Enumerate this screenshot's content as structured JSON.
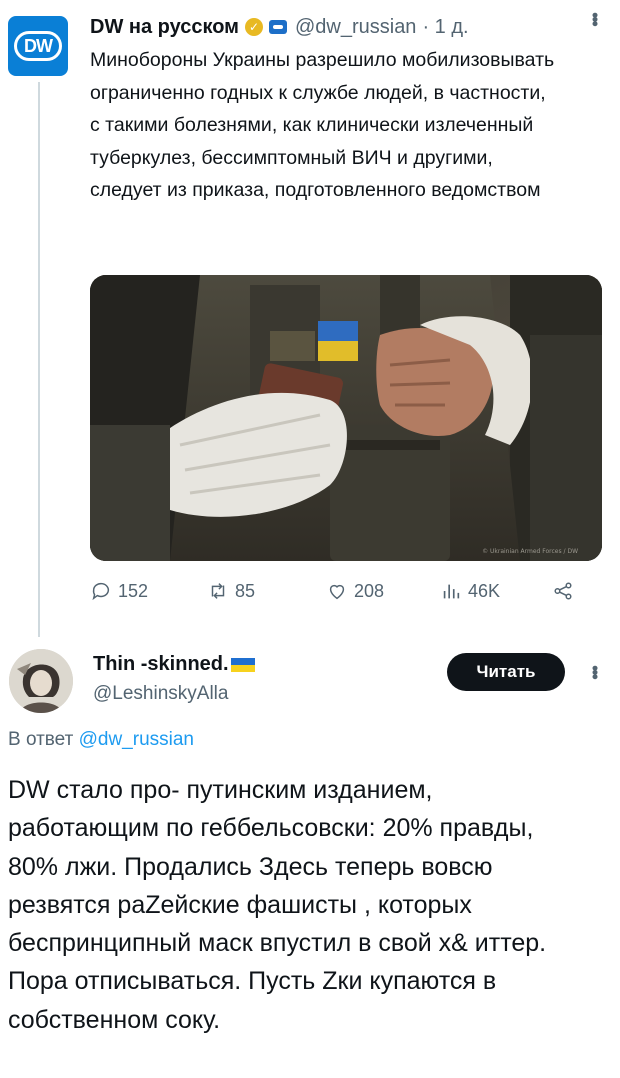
{
  "tweet": {
    "author_name": "DW на русском",
    "avatar_text": "DW",
    "handle": "@dw_russian",
    "time": "· 1 д.",
    "text": "Минобороны Украины разрешило мобилизовывать ограниченно годных к службе людей, в частности, с такими болезнями, как клинически излеченный туберкулез, бессимптомный ВИЧ и другими, следует из приказа, подготовленного ведомством",
    "media_credit": "© Ukrainian Armed Forces / DW",
    "actions": {
      "replies": "152",
      "reposts": "85",
      "likes": "208",
      "views": "46K"
    },
    "icons": [
      "verified-badge-icon",
      "affiliate-badge-icon",
      "more-icon",
      "reply-icon",
      "repost-icon",
      "like-icon",
      "views-icon",
      "share-icon"
    ]
  },
  "reply": {
    "author_name": "Thin -skinned.",
    "handle": "@LeshinskyAlla",
    "follow_label": "Читать",
    "reply_to_prefix": "В ответ",
    "reply_to_handle": "@dw_russian",
    "text": "DW стало про- путинским изданием, работающим по геббельсовски: 20% правды, 80% лжи. Продались Здесь теперь вовсю резвятся раZейские фашисты , которых беспринципный маск впустил в свой x& иттер. Пора отписываться. Пусть Zки купаются в собственном соку."
  },
  "colors": {
    "text": "#0f1419",
    "muted": "#536471",
    "link": "#1d9bf0",
    "dw_blue": "#0a7fd6",
    "button": "#0f1419"
  }
}
